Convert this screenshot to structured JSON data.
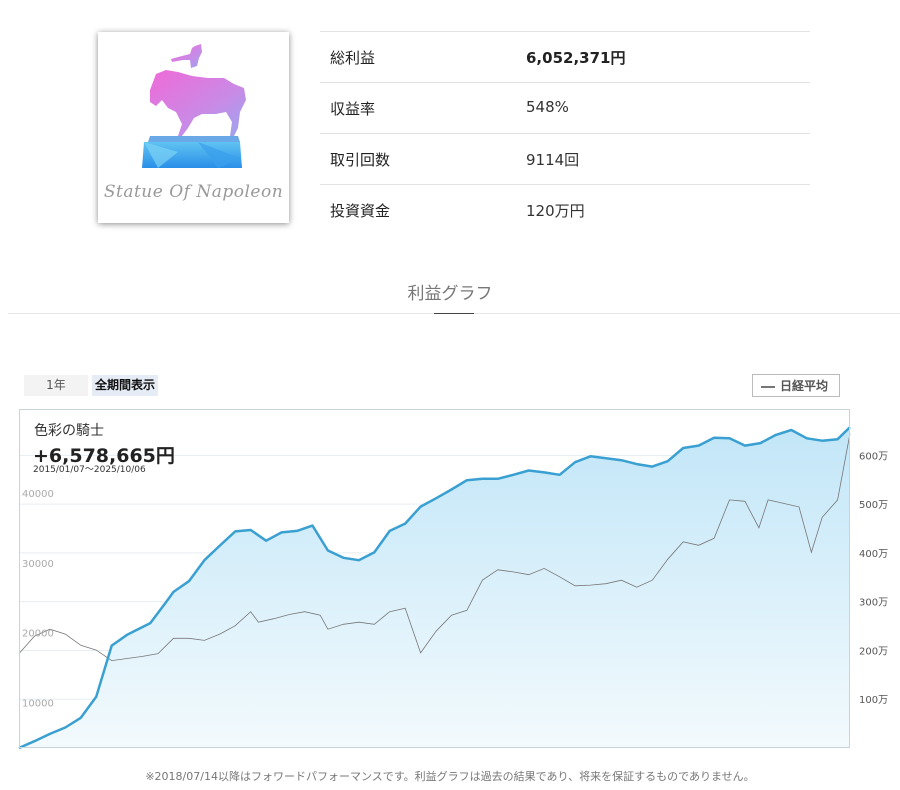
{
  "logo": {
    "text": "Statue Of Napoleon",
    "icon": "horse-statue-icon"
  },
  "stats": [
    {
      "label": "総利益",
      "value": "6,052,371円",
      "bold": true
    },
    {
      "label": "収益率",
      "value": "548%",
      "bold": false
    },
    {
      "label": "取引回数",
      "value": "9114回",
      "bold": false
    },
    {
      "label": "投資資金",
      "value": "120万円",
      "bold": false
    }
  ],
  "section": {
    "title": "利益グラフ"
  },
  "controls": {
    "period_1y": "1年",
    "period_all": "全期間表示",
    "legend_nikkei": "日経平均"
  },
  "overlay": {
    "name": "色彩の騎士",
    "total": "+6,578,665円",
    "range": "2015/01/07〜2025/10/06"
  },
  "footnote": "※2018/07/14以降はフォワードパフォーマンスです。利益グラフは過去の結果であり、将来を保証するものでありません。",
  "colors": {
    "profit_line": "#3a9fd1",
    "profit_fill_top": "#c2e6f8",
    "profit_fill_bottom": "#f3fafd",
    "nikkei_line": "#777777"
  },
  "chart_data": {
    "type": "line",
    "x_start": "2015/01/07",
    "x_end": "2025/10/06",
    "left_axis": {
      "ticks": [
        10000,
        20000,
        30000,
        40000
      ],
      "labels": [
        "10000",
        "20000",
        "30000",
        "40000"
      ],
      "ylim": [
        3500,
        52000
      ]
    },
    "right_axis": {
      "ticks": [
        1000000,
        2000000,
        3000000,
        4000000,
        5000000,
        6000000
      ],
      "labels": [
        "100万",
        "200万",
        "300万",
        "400万",
        "500万",
        "600万"
      ],
      "ylim": [
        0,
        6950000
      ]
    },
    "legend": "top-right",
    "series": [
      {
        "name": "色彩の騎士",
        "axis": "right",
        "x": [
          2015.0,
          2015.2,
          2015.4,
          2015.6,
          2015.8,
          2016.0,
          2016.2,
          2016.4,
          2016.5,
          2016.7,
          2016.9,
          2017.0,
          2017.2,
          2017.4,
          2017.6,
          2017.8,
          2018.0,
          2018.2,
          2018.4,
          2018.6,
          2018.8,
          2019.0,
          2019.2,
          2019.4,
          2019.6,
          2019.8,
          2020.0,
          2020.2,
          2020.4,
          2020.6,
          2020.8,
          2021.0,
          2021.2,
          2021.4,
          2021.6,
          2021.8,
          2022.0,
          2022.2,
          2022.4,
          2022.6,
          2022.8,
          2023.0,
          2023.2,
          2023.4,
          2023.6,
          2023.8,
          2024.0,
          2024.2,
          2024.4,
          2024.6,
          2024.8,
          2025.0,
          2025.2,
          2025.4,
          2025.6,
          2025.76
        ],
        "values": [
          0,
          140000,
          290000,
          420000,
          620000,
          1050000,
          2100000,
          2320000,
          2400000,
          2560000,
          2980000,
          3200000,
          3420000,
          3850000,
          4150000,
          4440000,
          4470000,
          4250000,
          4420000,
          4450000,
          4560000,
          4050000,
          3900000,
          3850000,
          4010000,
          4450000,
          4600000,
          4950000,
          5120000,
          5300000,
          5490000,
          5520000,
          5520000,
          5600000,
          5690000,
          5650000,
          5600000,
          5860000,
          5980000,
          5940000,
          5900000,
          5820000,
          5770000,
          5880000,
          6150000,
          6200000,
          6360000,
          6350000,
          6200000,
          6250000,
          6420000,
          6520000,
          6350000,
          6300000,
          6330000,
          6578665
        ]
      },
      {
        "name": "日経平均",
        "axis": "left",
        "x": [
          2015.0,
          2015.2,
          2015.4,
          2015.6,
          2015.8,
          2016.0,
          2016.2,
          2016.4,
          2016.6,
          2016.8,
          2017.0,
          2017.2,
          2017.4,
          2017.6,
          2017.8,
          2018.0,
          2018.1,
          2018.3,
          2018.5,
          2018.7,
          2018.9,
          2019.0,
          2019.2,
          2019.4,
          2019.6,
          2019.8,
          2020.0,
          2020.2,
          2020.4,
          2020.6,
          2020.8,
          2021.0,
          2021.2,
          2021.4,
          2021.6,
          2021.8,
          2022.0,
          2022.2,
          2022.4,
          2022.6,
          2022.8,
          2023.0,
          2023.2,
          2023.4,
          2023.6,
          2023.8,
          2024.0,
          2024.2,
          2024.4,
          2024.58,
          2024.7,
          2024.9,
          2025.1,
          2025.26,
          2025.4,
          2025.6,
          2025.76
        ],
        "values": [
          17000,
          19500,
          20500,
          19800,
          18200,
          17500,
          16000,
          16300,
          16600,
          17000,
          19200,
          19200,
          18900,
          19800,
          21000,
          23000,
          21500,
          22000,
          22600,
          23000,
          22500,
          20500,
          21200,
          21500,
          21200,
          23000,
          23500,
          17100,
          20200,
          22500,
          23200,
          27500,
          29000,
          28700,
          28300,
          29200,
          28000,
          26700,
          26800,
          27000,
          27500,
          26500,
          27500,
          30500,
          33000,
          32500,
          33500,
          39000,
          38800,
          35000,
          39000,
          38500,
          38000,
          31500,
          36500,
          39000,
          48500
        ]
      }
    ]
  }
}
